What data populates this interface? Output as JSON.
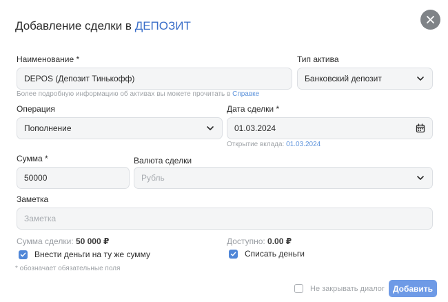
{
  "dialog": {
    "title_prefix": "Добавление сделки в",
    "title_accent": "ДЕПОЗИТ",
    "close_icon": "close-icon"
  },
  "form": {
    "name": {
      "label": "Наименование *",
      "value": "DEPOS (Депозит Тинькофф)"
    },
    "asset_type": {
      "label": "Тип актива",
      "value": "Банковский депозит"
    },
    "info_hint": {
      "text": "Более подробную информацию об активах вы можете прочитать в",
      "link": "Справке"
    },
    "operation": {
      "label": "Операция",
      "value": "Пополнение"
    },
    "deal_date": {
      "label": "Дата сделки *",
      "value": "01.03.2024",
      "hint": "Открытие вклада:",
      "hint_link": "01.03.2024"
    },
    "amount": {
      "label": "Сумма *",
      "value": "50000"
    },
    "currency": {
      "label": "Валюта сделки",
      "placeholder": "Рубль"
    },
    "note": {
      "label": "Заметка",
      "placeholder": "Заметка"
    }
  },
  "summary": {
    "deal_sum_label": "Сумма сделки:",
    "deal_sum_value": "50 000 ₽",
    "available_label": "Доступно:",
    "available_value": "0.00 ₽"
  },
  "checkboxes": {
    "deposit_same": {
      "label": "Внести деньги на ту же сумму",
      "checked": true
    },
    "withdraw": {
      "label": "Списать деньги",
      "checked": true
    },
    "keep_open": {
      "label": "Не закрывать диалог",
      "checked": false
    }
  },
  "required_note": "* обозначает обязательные поля",
  "actions": {
    "submit": "Добавить"
  },
  "colors": {
    "accent": "#3b6fc9",
    "primary_button": "#6e9ae6",
    "checkbox": "#4f86d8",
    "close_button": "#7f8387"
  }
}
